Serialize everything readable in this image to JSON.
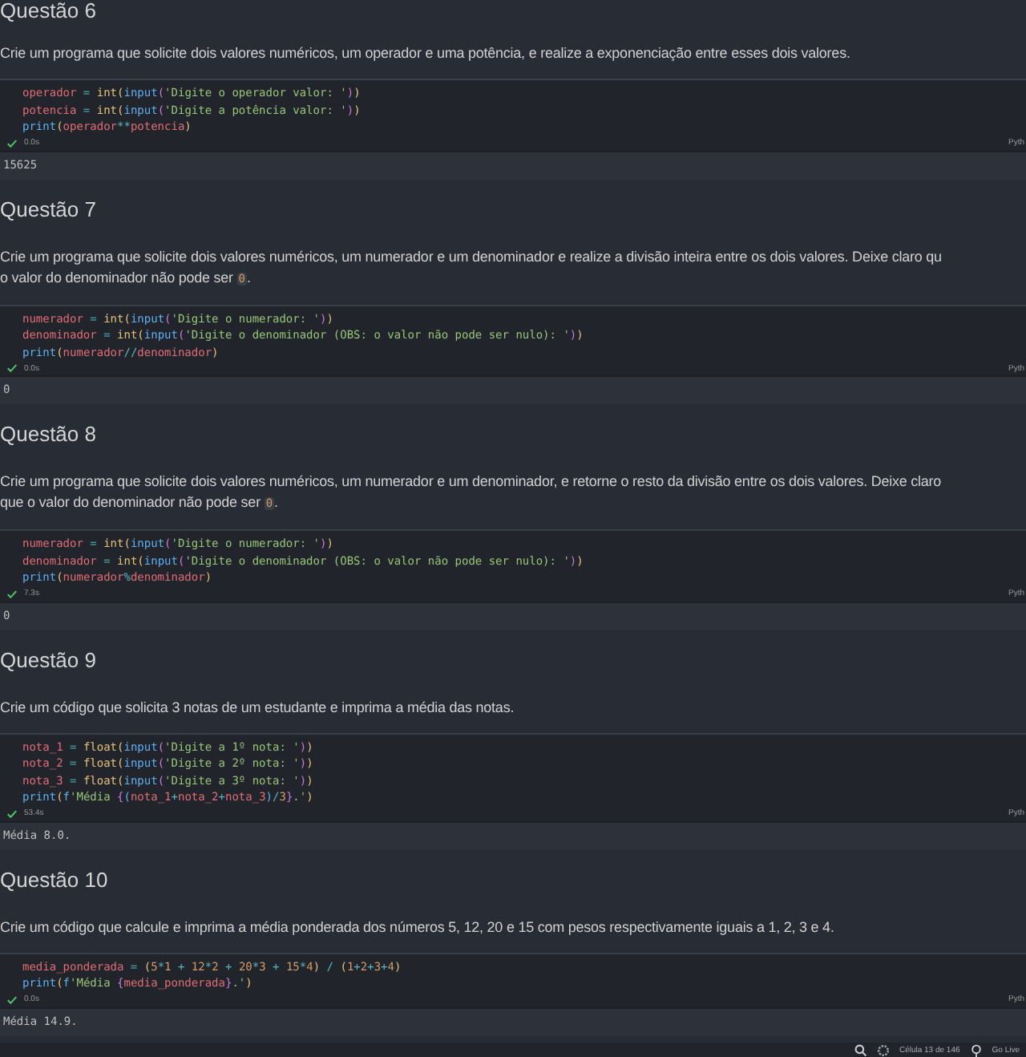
{
  "sections": [
    {
      "heading": "Questão 6",
      "paragraph": [
        [
          {
            "text": "Crie um programa que solicite dois valores numéricos, um operador e uma potência, e realize a exponenciação entre esses dois valores.",
            "kind": "text"
          }
        ]
      ],
      "code": [
        [
          {
            "text": "operador",
            "kind": "var"
          },
          {
            "text": " = ",
            "kind": "op"
          },
          {
            "text": "int",
            "kind": "type"
          },
          {
            "text": "(",
            "kind": "b1"
          },
          {
            "text": "input",
            "kind": "func"
          },
          {
            "text": "(",
            "kind": "b2"
          },
          {
            "text": "'Digite o operador valor: '",
            "kind": "str"
          },
          {
            "text": ")",
            "kind": "b2"
          },
          {
            "text": ")",
            "kind": "b1"
          }
        ],
        [
          {
            "text": "potencia",
            "kind": "var"
          },
          {
            "text": " = ",
            "kind": "op"
          },
          {
            "text": "int",
            "kind": "type"
          },
          {
            "text": "(",
            "kind": "b1"
          },
          {
            "text": "input",
            "kind": "func"
          },
          {
            "text": "(",
            "kind": "b2"
          },
          {
            "text": "'Digite a potência valor: '",
            "kind": "str"
          },
          {
            "text": ")",
            "kind": "b2"
          },
          {
            "text": ")",
            "kind": "b1"
          }
        ],
        [
          {
            "text": "print",
            "kind": "func"
          },
          {
            "text": "(",
            "kind": "b1"
          },
          {
            "text": "operador",
            "kind": "var"
          },
          {
            "text": "**",
            "kind": "op"
          },
          {
            "text": "potencia",
            "kind": "var"
          },
          {
            "text": ")",
            "kind": "b1"
          }
        ]
      ],
      "status": {
        "succeeded": true,
        "time": "0.0s",
        "language": "Pyth"
      },
      "output": "15625"
    },
    {
      "heading": "Questão 7",
      "paragraph": [
        [
          {
            "text": "Crie um programa que solicite dois valores numéricos, um numerador e um denominador e realize a divisão inteira entre os dois valores. Deixe claro qu",
            "kind": "text"
          }
        ],
        [
          {
            "text": "o valor do denominador não pode ser ",
            "kind": "text"
          },
          {
            "text": "0",
            "kind": "code"
          },
          {
            "text": ".",
            "kind": "text"
          }
        ]
      ],
      "code": [
        [
          {
            "text": "numerador",
            "kind": "var"
          },
          {
            "text": " = ",
            "kind": "op"
          },
          {
            "text": "int",
            "kind": "type"
          },
          {
            "text": "(",
            "kind": "b1"
          },
          {
            "text": "input",
            "kind": "func"
          },
          {
            "text": "(",
            "kind": "b2"
          },
          {
            "text": "'Digite o numerador: '",
            "kind": "str"
          },
          {
            "text": ")",
            "kind": "b2"
          },
          {
            "text": ")",
            "kind": "b1"
          }
        ],
        [
          {
            "text": "denominador",
            "kind": "var"
          },
          {
            "text": " = ",
            "kind": "op"
          },
          {
            "text": "int",
            "kind": "type"
          },
          {
            "text": "(",
            "kind": "b1"
          },
          {
            "text": "input",
            "kind": "func"
          },
          {
            "text": "(",
            "kind": "b2"
          },
          {
            "text": "'Digite o denominador (OBS: o valor não pode ser nulo): '",
            "kind": "str"
          },
          {
            "text": ")",
            "kind": "b2"
          },
          {
            "text": ")",
            "kind": "b1"
          }
        ],
        [
          {
            "text": "print",
            "kind": "func"
          },
          {
            "text": "(",
            "kind": "b1"
          },
          {
            "text": "numerador",
            "kind": "var"
          },
          {
            "text": "//",
            "kind": "op"
          },
          {
            "text": "denominador",
            "kind": "var"
          },
          {
            "text": ")",
            "kind": "b1"
          }
        ]
      ],
      "status": {
        "succeeded": true,
        "time": "0.0s",
        "language": "Pyth"
      },
      "output": "0"
    },
    {
      "heading": "Questão 8",
      "paragraph": [
        [
          {
            "text": "Crie um programa que solicite dois valores numéricos, um numerador e um denominador, e retorne o resto da divisão entre os dois valores. Deixe claro",
            "kind": "text"
          }
        ],
        [
          {
            "text": "que o valor do denominador não pode ser ",
            "kind": "text"
          },
          {
            "text": "0",
            "kind": "code"
          },
          {
            "text": ".",
            "kind": "text"
          }
        ]
      ],
      "code": [
        [
          {
            "text": "numerador",
            "kind": "var"
          },
          {
            "text": " = ",
            "kind": "op"
          },
          {
            "text": "int",
            "kind": "type"
          },
          {
            "text": "(",
            "kind": "b1"
          },
          {
            "text": "input",
            "kind": "func"
          },
          {
            "text": "(",
            "kind": "b2"
          },
          {
            "text": "'Digite o numerador: '",
            "kind": "str"
          },
          {
            "text": ")",
            "kind": "b2"
          },
          {
            "text": ")",
            "kind": "b1"
          }
        ],
        [
          {
            "text": "denominador",
            "kind": "var"
          },
          {
            "text": " = ",
            "kind": "op"
          },
          {
            "text": "int",
            "kind": "type"
          },
          {
            "text": "(",
            "kind": "b1"
          },
          {
            "text": "input",
            "kind": "func"
          },
          {
            "text": "(",
            "kind": "b2"
          },
          {
            "text": "'Digite o denominador (OBS: o valor não pode ser nulo): '",
            "kind": "str"
          },
          {
            "text": ")",
            "kind": "b2"
          },
          {
            "text": ")",
            "kind": "b1"
          }
        ],
        [
          {
            "text": "print",
            "kind": "func"
          },
          {
            "text": "(",
            "kind": "b1"
          },
          {
            "text": "numerador",
            "kind": "var"
          },
          {
            "text": "%",
            "kind": "op"
          },
          {
            "text": "denominador",
            "kind": "var"
          },
          {
            "text": ")",
            "kind": "b1"
          }
        ]
      ],
      "status": {
        "succeeded": true,
        "time": "7.3s",
        "language": "Pyth"
      },
      "output": "0"
    },
    {
      "heading": "Questão 9",
      "paragraph": [
        [
          {
            "text": "Crie um código que solicita 3 notas de um estudante e imprima a média das notas.",
            "kind": "text"
          }
        ]
      ],
      "code": [
        [
          {
            "text": "nota_1",
            "kind": "var"
          },
          {
            "text": " = ",
            "kind": "op"
          },
          {
            "text": "float",
            "kind": "type"
          },
          {
            "text": "(",
            "kind": "b1"
          },
          {
            "text": "input",
            "kind": "func"
          },
          {
            "text": "(",
            "kind": "b2"
          },
          {
            "text": "'Digite a 1º nota: '",
            "kind": "str"
          },
          {
            "text": ")",
            "kind": "b2"
          },
          {
            "text": ")",
            "kind": "b1"
          }
        ],
        [
          {
            "text": "nota_2",
            "kind": "var"
          },
          {
            "text": " = ",
            "kind": "op"
          },
          {
            "text": "float",
            "kind": "type"
          },
          {
            "text": "(",
            "kind": "b1"
          },
          {
            "text": "input",
            "kind": "func"
          },
          {
            "text": "(",
            "kind": "b2"
          },
          {
            "text": "'Digite a 2º nota: '",
            "kind": "str"
          },
          {
            "text": ")",
            "kind": "b2"
          },
          {
            "text": ")",
            "kind": "b1"
          }
        ],
        [
          {
            "text": "nota_3",
            "kind": "var"
          },
          {
            "text": " = ",
            "kind": "op"
          },
          {
            "text": "float",
            "kind": "type"
          },
          {
            "text": "(",
            "kind": "b1"
          },
          {
            "text": "input",
            "kind": "func"
          },
          {
            "text": "(",
            "kind": "b2"
          },
          {
            "text": "'Digite a 3º nota: '",
            "kind": "str"
          },
          {
            "text": ")",
            "kind": "b2"
          },
          {
            "text": ")",
            "kind": "b1"
          }
        ],
        [
          {
            "text": "print",
            "kind": "func"
          },
          {
            "text": "(",
            "kind": "b1"
          },
          {
            "text": "f",
            "kind": "func"
          },
          {
            "text": "'Média ",
            "kind": "str"
          },
          {
            "text": "{",
            "kind": "b2"
          },
          {
            "text": "(",
            "kind": "b3"
          },
          {
            "text": "nota_1",
            "kind": "var"
          },
          {
            "text": "+",
            "kind": "op"
          },
          {
            "text": "nota_2",
            "kind": "var"
          },
          {
            "text": "+",
            "kind": "op"
          },
          {
            "text": "nota_3",
            "kind": "var"
          },
          {
            "text": ")",
            "kind": "b3"
          },
          {
            "text": "/",
            "kind": "op"
          },
          {
            "text": "3",
            "kind": "num"
          },
          {
            "text": "}",
            "kind": "b2"
          },
          {
            "text": ".'",
            "kind": "str"
          },
          {
            "text": ")",
            "kind": "b1"
          }
        ]
      ],
      "status": {
        "succeeded": true,
        "time": "53.4s",
        "language": "Pyth"
      },
      "output": "Média 8.0."
    },
    {
      "heading": "Questão 10",
      "paragraph": [
        [
          {
            "text": "Crie um código que calcule e imprima a média ponderada dos números 5, 12, 20 e 15 com pesos respectivamente iguais a 1, 2, 3 e 4.",
            "kind": "text"
          }
        ]
      ],
      "code": [
        [
          {
            "text": "media_ponderada",
            "kind": "var"
          },
          {
            "text": " = ",
            "kind": "op"
          },
          {
            "text": "(",
            "kind": "b1"
          },
          {
            "text": "5",
            "kind": "num"
          },
          {
            "text": "*",
            "kind": "op"
          },
          {
            "text": "1",
            "kind": "num"
          },
          {
            "text": " + ",
            "kind": "op"
          },
          {
            "text": "12",
            "kind": "num"
          },
          {
            "text": "*",
            "kind": "op"
          },
          {
            "text": "2",
            "kind": "num"
          },
          {
            "text": " + ",
            "kind": "op"
          },
          {
            "text": "20",
            "kind": "num"
          },
          {
            "text": "*",
            "kind": "op"
          },
          {
            "text": "3",
            "kind": "num"
          },
          {
            "text": " + ",
            "kind": "op"
          },
          {
            "text": "15",
            "kind": "num"
          },
          {
            "text": "*",
            "kind": "op"
          },
          {
            "text": "4",
            "kind": "num"
          },
          {
            "text": ")",
            "kind": "b1"
          },
          {
            "text": " / ",
            "kind": "op"
          },
          {
            "text": "(",
            "kind": "b1"
          },
          {
            "text": "1",
            "kind": "num"
          },
          {
            "text": "+",
            "kind": "op"
          },
          {
            "text": "2",
            "kind": "num"
          },
          {
            "text": "+",
            "kind": "op"
          },
          {
            "text": "3",
            "kind": "num"
          },
          {
            "text": "+",
            "kind": "op"
          },
          {
            "text": "4",
            "kind": "num"
          },
          {
            "text": ")",
            "kind": "b1"
          }
        ],
        [
          {
            "text": "print",
            "kind": "func"
          },
          {
            "text": "(",
            "kind": "b1"
          },
          {
            "text": "f",
            "kind": "func"
          },
          {
            "text": "'Média ",
            "kind": "str"
          },
          {
            "text": "{",
            "kind": "b2"
          },
          {
            "text": "media_ponderada",
            "kind": "var"
          },
          {
            "text": "}",
            "kind": "b2"
          },
          {
            "text": ".'",
            "kind": "str"
          },
          {
            "text": ")",
            "kind": "b1"
          }
        ]
      ],
      "status": {
        "succeeded": true,
        "time": "0.0s",
        "language": "Pyth"
      },
      "output": "Média 14.9."
    }
  ],
  "status_bar": {
    "cell_position": "Célula 13 de 146",
    "go_live": "Go Live"
  }
}
